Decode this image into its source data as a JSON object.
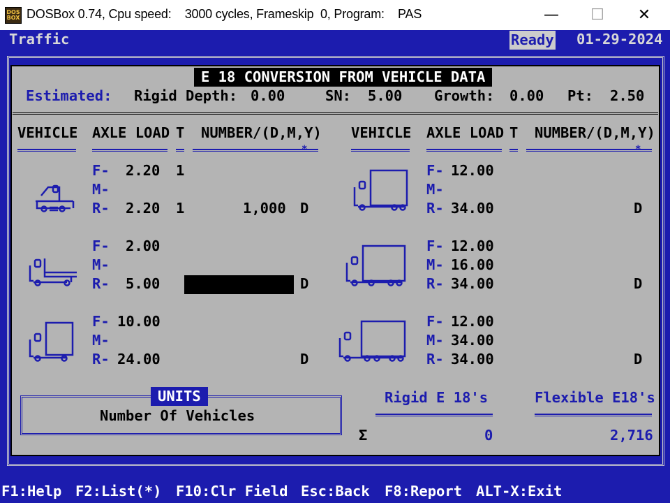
{
  "window": {
    "title": "DOSBox 0.74, Cpu speed:    3000 cycles, Frameskip  0, Program:    PAS",
    "icon_text": "DOS BOX",
    "minimize": "—",
    "maximize": "☐",
    "close": "✕"
  },
  "statusbar": {
    "app": "Traffic",
    "status": "Ready",
    "date": "01-29-2024"
  },
  "panel": {
    "title": "E 18 CONVERSION FROM VEHICLE DATA",
    "estimated": {
      "label": "Estimated:",
      "rigid_depth_label": "Rigid Depth:",
      "rigid_depth_value": "0.00",
      "sn_label": "SN:",
      "sn_value": "5.00",
      "growth_label": "Growth:",
      "growth_value": "0.00",
      "pt_label": "Pt:",
      "pt_value": "2.50"
    },
    "headers": {
      "vehicle": "VEHICLE",
      "axle_load": "AXLE LOAD",
      "t": "T",
      "number": "NUMBER/(D,M,Y)",
      "star": "*"
    },
    "axle_labels": {
      "f": "F-",
      "m": "M-",
      "r": "R-"
    },
    "left_vehicles": [
      {
        "icon": "pickup-truck-icon",
        "f": "2.20",
        "m": "",
        "r": "2.20",
        "t_f": "1",
        "t_r": "1",
        "number": "1,000",
        "period": "D"
      },
      {
        "icon": "flatbed-truck-icon",
        "f": "2.00",
        "m": "",
        "r": "5.00",
        "t_f": "",
        "t_r": "",
        "number": "",
        "period": "D"
      },
      {
        "icon": "box-truck-2axle-icon",
        "f": "10.00",
        "m": "",
        "r": "24.00",
        "t_f": "",
        "t_r": "",
        "number": "",
        "period": "D"
      }
    ],
    "right_vehicles": [
      {
        "icon": "box-truck-tandem-icon",
        "f": "12.00",
        "m": "",
        "r": "34.00",
        "number": "",
        "period": "D"
      },
      {
        "icon": "box-truck-3axle-icon",
        "f": "12.00",
        "m": "16.00",
        "r": "34.00",
        "number": "",
        "period": "D"
      },
      {
        "icon": "box-truck-4axle-icon",
        "f": "12.00",
        "m": "34.00",
        "r": "34.00",
        "number": "",
        "period": "D"
      }
    ],
    "units": {
      "label": "UNITS",
      "value": "Number Of Vehicles"
    },
    "totals": {
      "rigid_label": "Rigid E 18's",
      "flexible_label": "Flexible E18's",
      "sigma": "Σ",
      "rigid_value": "0",
      "flexible_value": "2,716"
    }
  },
  "function_keys": [
    "F1:Help",
    "F2:List(*)",
    "F10:Clr Field",
    "Esc:Back",
    "F8:Report",
    "ALT-X:Exit"
  ]
}
